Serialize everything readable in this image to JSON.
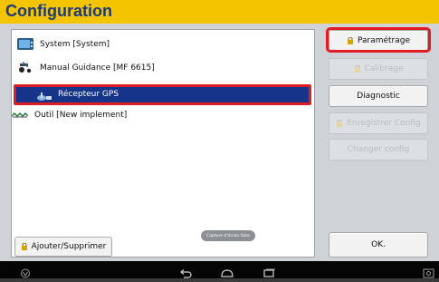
{
  "window": {
    "title": "Configuration"
  },
  "tree": {
    "items": [
      {
        "label": "System [System]",
        "icon": "system-icon"
      },
      {
        "label": "Manual Guidance [MF 6615]",
        "icon": "guidance-icon"
      },
      {
        "label": "Récepteur GPS",
        "icon": "gps-receiver-icon",
        "selected": true
      },
      {
        "label": "Outil [New implement]",
        "icon": "implement-icon"
      }
    ]
  },
  "buttons": {
    "parametrage": "Paramétrage",
    "calibrage": "Calibrage",
    "diagnostic": "Diagnostic",
    "enregistrer": "Enregistrer Config",
    "changer": "Changer config",
    "ajouter": "Ajouter/Supprimer",
    "ok": "OK."
  },
  "toast": {
    "text": "Capture d'écran faite"
  },
  "colors": {
    "title_bar": "#f5c400",
    "selection": "#16348a",
    "highlight": "#e11b22"
  }
}
